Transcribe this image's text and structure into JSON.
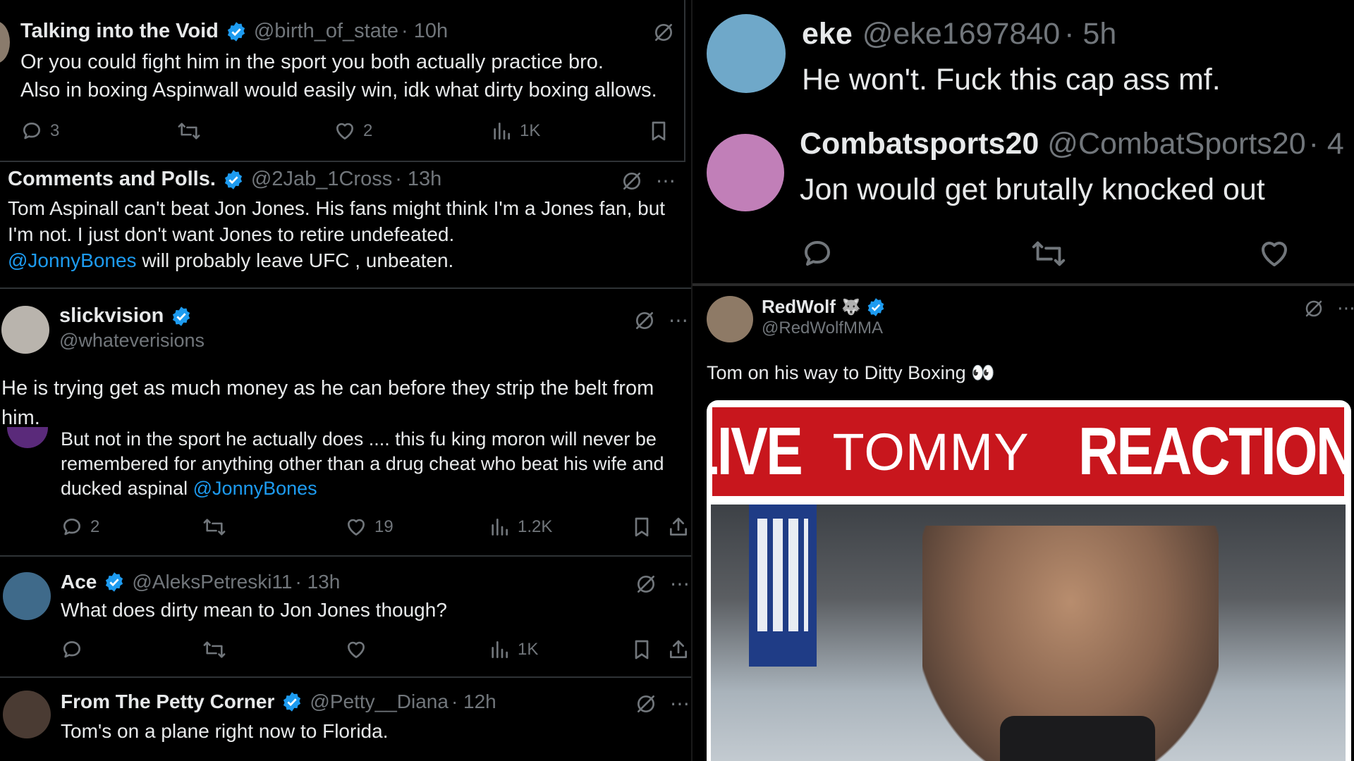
{
  "left_column": {
    "tweet1": {
      "name": "Talking into the Void",
      "handle": "@birth_of_state",
      "time": "· 10h",
      "line1": "Or you could fight him in the sport you both actually practice bro.",
      "line2": "Also in boxing Aspinwall would easily win, idk what dirty boxing allows.",
      "replies": "3",
      "likes": "2",
      "views": "1K"
    },
    "tweet2": {
      "name": "Comments and Polls.",
      "handle": "@2Jab_1Cross",
      "time": "· 13h",
      "line1": "Tom Aspinall can't beat Jon Jones. His fans might think I'm a Jones fan, but",
      "line2": "I'm not. I just don't want Jones to retire undefeated.",
      "mention": "@JonnyBones",
      "line3_rest": " will probably leave UFC , unbeaten."
    },
    "tweet3": {
      "name": "slickvision",
      "handle": "@whateverisions",
      "line1": "He is trying get as much money as he can before they strip the belt from",
      "line2": "him.",
      "quote_line1": "But not in the sport he actually does .... this fu king moron will never be",
      "quote_line2": "remembered for anything other than a drug cheat who beat his wife and",
      "quote_line3_pre": "ducked aspinal ",
      "quote_mention": "@JonnyBones",
      "replies": "2",
      "likes": "19",
      "views": "1.2K"
    },
    "tweet4": {
      "name": "Ace",
      "handle": "@AleksPetreski11",
      "time": "· 13h",
      "text": "What does dirty mean to Jon Jones though?",
      "views": "1K"
    },
    "tweet5": {
      "name": "From The Petty Corner",
      "handle": "@Petty__Diana",
      "time": "· 12h",
      "text": "Tom's on a plane right now to Florida."
    }
  },
  "right_column": {
    "tweet1": {
      "name": "eke",
      "handle": "@eke1697840",
      "time": "· 5h",
      "text": "He won't. Fuck this cap ass mf."
    },
    "tweet2": {
      "name": "Combatsports20",
      "handle": "@CombatSports20",
      "time": "· 4",
      "text": "Jon would get brutally knocked out"
    },
    "tweet3": {
      "name": "RedWolf",
      "handle": "@RedWolfMMA",
      "text": "Tom on his way to Ditty Boxing 👀",
      "banner_live": "LIVE",
      "banner_tommy": "TOMMY",
      "banner_reaction": "REACTION"
    }
  },
  "colors": {
    "background": "#000000",
    "text": "#e7e9ea",
    "muted": "#71767b",
    "link": "#1d9bf0",
    "verified": "#1d9bf0",
    "banner_red": "#c8161d"
  }
}
